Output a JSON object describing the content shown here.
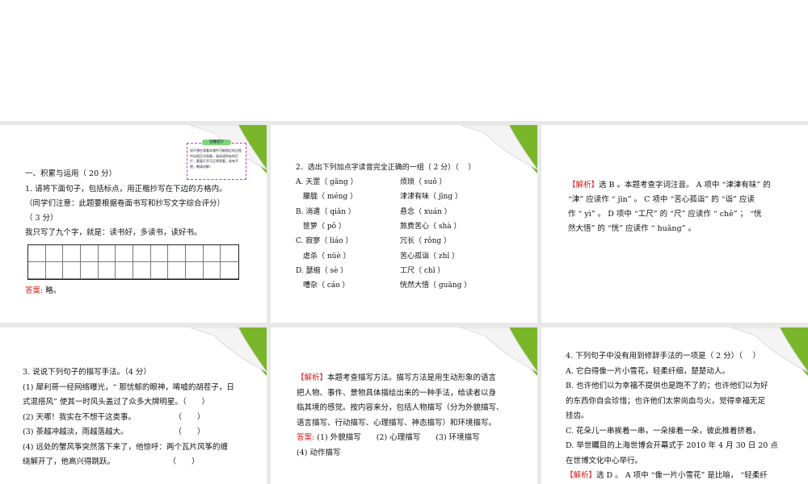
{
  "slide1": {
    "tip_title": "温馨提示",
    "tip_body": "如不想在观看本课件可能稍后的过程中出现压字现象，请关闭所有的灯片，重复打开可正常观看，若有不便，敬请谅解！",
    "section": "一、积累与运用（ 20 分）",
    "q1": "1. 请将下面句子，包括标点，用正楷抄写在下边的方格内。",
    "note": "（同学们注意：此题要根据卷面书写和抄写文字综合评分）",
    "score": "（ 3 分）",
    "sentence": "我只写了九个字，就是：读书好，多读书，读好书。",
    "answer_label": "答案:",
    "answer": "略。"
  },
  "slide2": {
    "question": "2．选出下列加点字读音完全正确的一组（ 2 分）（　 ）",
    "rows": [
      [
        "A. 天罡（ gāng ）",
        "烦琐（ suǒ ）"
      ],
      [
        "　朦胧（ méng ）",
        "津津有味（ jīng ）"
      ],
      [
        "B. 消遣（ qiǎn ）",
        "悬念（ xuán ）"
      ],
      [
        "　笸箩（ pǒ ）",
        "煞费苦心（ shà ）"
      ],
      [
        "C. 寂寥（ liáo ）",
        "冗长（ rǒng ）"
      ],
      [
        "　虐杀（ nüè ）",
        "苦心孤诣（ zhǐ ）"
      ],
      [
        "D. 瑟缩（ sè ）",
        "工尺（ chǐ ）"
      ],
      [
        "　嘈杂（ cáo ）",
        "恍然大悟（ guāng ）"
      ]
    ]
  },
  "slide3": {
    "label": "【解析】",
    "lines": [
      "选 B 。本题考查字词注音。 A 项中 “津津有味” 的",
      "“津” 应读作 “ jīn” 。 C 项中 “苦心孤诣” 的 “诣” 应读",
      "作 “ yì” 。 D 项中 “工尺” 的 “尺” 应读作 “ chě” ； “恍",
      "然大悟” 的 “恍” 应读作 “ huǎng” 。"
    ]
  },
  "slide4": {
    "lines": [
      "3. 说说下列句子的描写手法。（4 分）",
      "(1) 犀利哥一经网络曝光，“ 那忧郁的眼神，唏嘘的胡茬子，日",
      "式混搭风” 使其一时风头盖过了众多大牌明星。（　　）",
      "(2) 天哪！我实在不想干这类事。　　　　　　（　　）",
      "(3) 茶越冲越淡，雨越落越大。　　　　　　　（　　）",
      "(4) 远处的蟹风筝突然落下来了，他惊呼：两个瓦片风筝的缠",
      "绕解开了，他高兴得跳跃。　　　　　　　　（　　）"
    ]
  },
  "slide5": {
    "label": "【解析】",
    "lines": [
      "本题考查描写方法。描写方法是用生动形象的语言",
      "把人物、事件、景物具体描绘出来的一种手法，给读者以身",
      "临其境的感觉。按内容来分，包括人物描写（分为外貌描写、",
      "语言描写、行动描写、心理描写、神态描写）和环境描写。"
    ],
    "answer_label": "答案:",
    "answers": "(1) 外貌描写　　(2) 心理描写　　(3) 环境描写",
    "answer4": "(4) 动作描写"
  },
  "slide6": {
    "lines": [
      "4. 下列句子中没有用到修辞手法的一项是（ 2 分）（　 ）",
      "A. 它白得像一片小雪花，轻柔纤细，楚楚动人。",
      "B. 也许他们以为幸福不提供也是跑不了的；也许他们以为好",
      "的东西你自会珍惜；也许他们太崇尚血与火，觉得幸福无足",
      "挂齿。",
      "C. 花朵儿一串挨着一串，一朵接着一朵，彼此推着挤着。",
      "D. 举世瞩目的上海世博会开幕式于 2010 年 4 月 30 日 20 点",
      "在世博文化中心举行。"
    ],
    "label": "【解析】",
    "last": "选 D 。 A 项中 “像一片小雪花” 是比喻， “轻柔纤"
  }
}
